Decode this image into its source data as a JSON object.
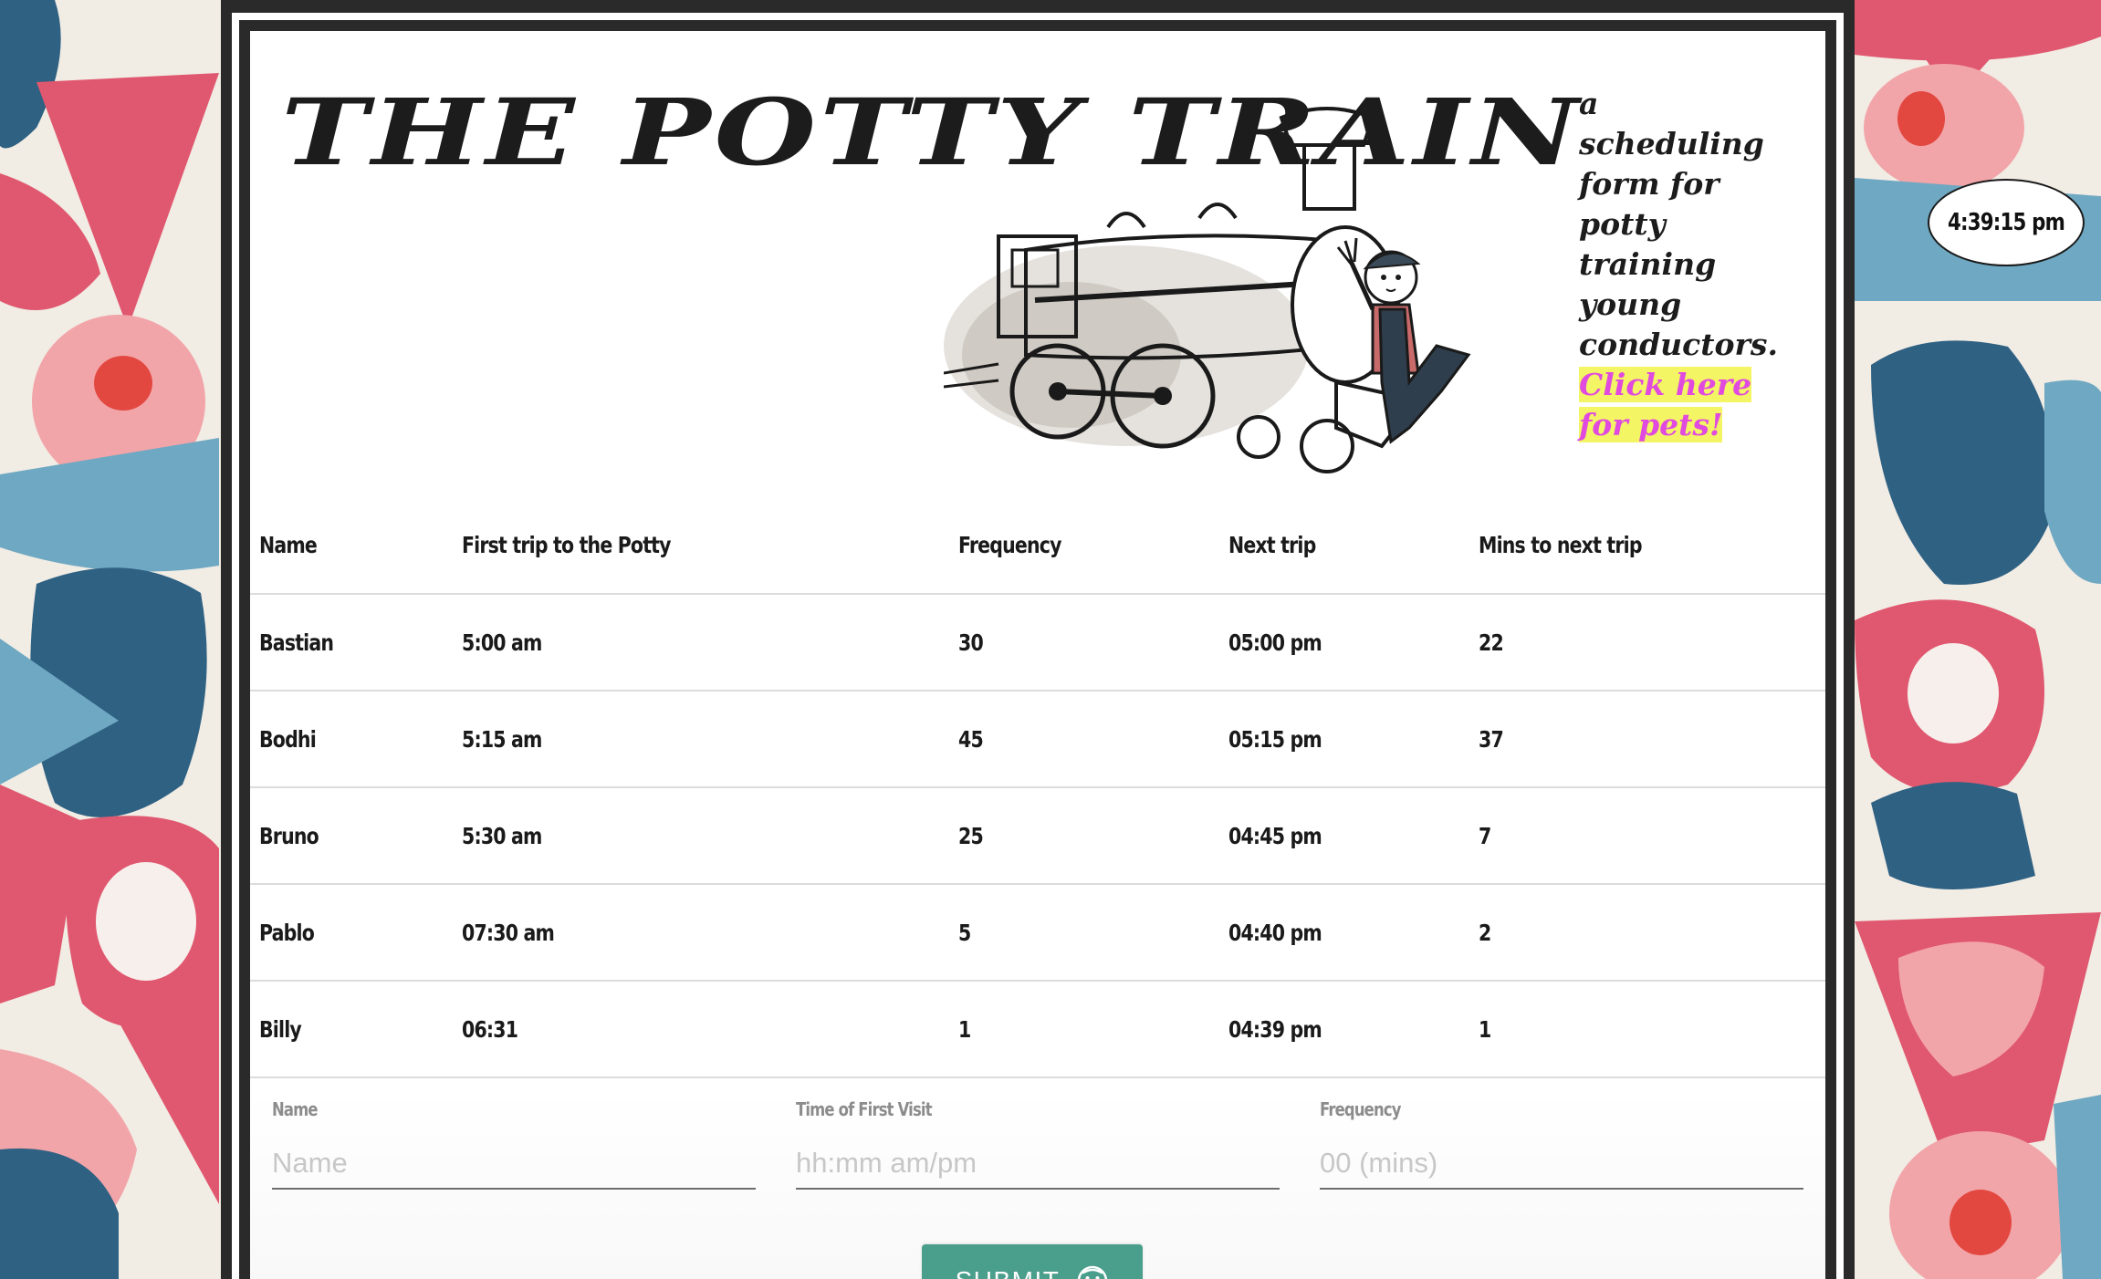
{
  "header": {
    "title": "THE POTTY TRAIN",
    "tagline_lines": [
      "a",
      "scheduling",
      "form for",
      "potty",
      "training",
      "young",
      "conductors."
    ],
    "pets_link": "Click here for pets!"
  },
  "clock": {
    "time": "4:39:15 pm"
  },
  "table": {
    "headers": [
      "Name",
      "First trip to the Potty",
      "Frequency",
      "Next trip",
      "Mins to next trip"
    ],
    "rows": [
      [
        "Bastian",
        "5:00 am",
        "30",
        "05:00 pm",
        "22"
      ],
      [
        "Bodhi",
        "5:15 am",
        "45",
        "05:15 pm",
        "37"
      ],
      [
        "Bruno",
        "5:30 am",
        "25",
        "04:45 pm",
        "7"
      ],
      [
        "Pablo",
        "07:30 am",
        "5",
        "04:40 pm",
        "2"
      ],
      [
        "Billy",
        "06:31",
        "1",
        "04:39 pm",
        "1"
      ]
    ]
  },
  "form": {
    "name_label": "Name",
    "name_placeholder": "Name",
    "time_label": "Time of First Visit",
    "time_placeholder": "hh:mm am/pm",
    "freq_label": "Frequency",
    "freq_placeholder": "00 (mins)",
    "submit_label": "SUBMIT"
  },
  "colors": {
    "frame": "#2a2a2a",
    "link_text": "#e04adf",
    "link_highlight": "#f3f564",
    "submit_bg": "#4a9e8c",
    "bg_pink": "#e0586f",
    "bg_blue": "#2f6183",
    "bg_light_blue": "#6fa8c2"
  },
  "icons": {
    "submit": "smiley-face-icon",
    "illustration": "steam-train-with-conductor"
  }
}
